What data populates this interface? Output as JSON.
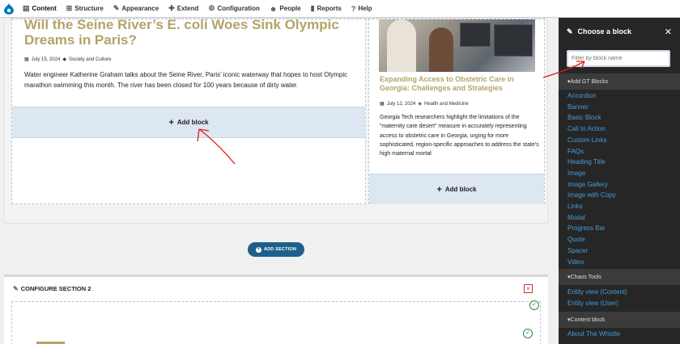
{
  "toolbar": {
    "items": [
      {
        "label": "Content",
        "icon": "content-icon"
      },
      {
        "label": "Structure",
        "icon": "structure-icon"
      },
      {
        "label": "Appearance",
        "icon": "appearance-icon"
      },
      {
        "label": "Extend",
        "icon": "extend-icon"
      },
      {
        "label": "Configuration",
        "icon": "wrench-icon"
      },
      {
        "label": "People",
        "icon": "people-icon"
      },
      {
        "label": "Reports",
        "icon": "reports-icon"
      },
      {
        "label": "Help",
        "icon": "help-icon"
      }
    ]
  },
  "left_article": {
    "title": "Will the Seine River’s E. coli Woes Sink Olympic Dreams in Paris?",
    "date": "July 15, 2024",
    "category": "Society and Culture",
    "body": "Water engineer Katherine Graham talks about the Seine River, Paris’ iconic waterway that hopes to host Olympic marathon swimming this month. The river has been closed for 100 years because of dirty water."
  },
  "right_article": {
    "title": "Expanding Access to Obstetric Care in Georgia: Challenges and Strategies",
    "date": "July 12, 2024",
    "category": "Health and Medicine",
    "body": "Georgia Tech researchers highlight the limitations of the “maternity care desert” measure in accurately representing access to obstetric care in Georgia, urging for more sophisticated, region-specific approaches to address the state’s high maternal mortal"
  },
  "add_block_label": "Add block",
  "add_section_label": "ADD SECTION",
  "section2": {
    "configure_label": "CONFIGURE SECTION 2"
  },
  "sidebar": {
    "title": "Choose a block",
    "filter_placeholder": "Filter by block name",
    "categories": [
      {
        "label": "Add GT Blocks",
        "items": [
          "Accordion",
          "Banner",
          "Basic Block",
          "Call to Action",
          "Custom Links",
          "FAQs",
          "Heading Title",
          "Image",
          "Image Gallery",
          "Image with Copy",
          "Links",
          "Modal",
          "Progress Bar",
          "Quote",
          "Spacer",
          "Video"
        ]
      },
      {
        "label": "Chaos Tools",
        "items": [
          "Entity view (Content)",
          "Entity view (User)"
        ]
      },
      {
        "label": "Content block",
        "items": [
          "About The Whistle"
        ]
      }
    ]
  },
  "colors": {
    "gold": "#b3a369",
    "link_blue": "#4a9bd6",
    "sidebar_bg": "#262626",
    "section_button": "#1f5f8b",
    "annotation_red": "#e0201b"
  }
}
